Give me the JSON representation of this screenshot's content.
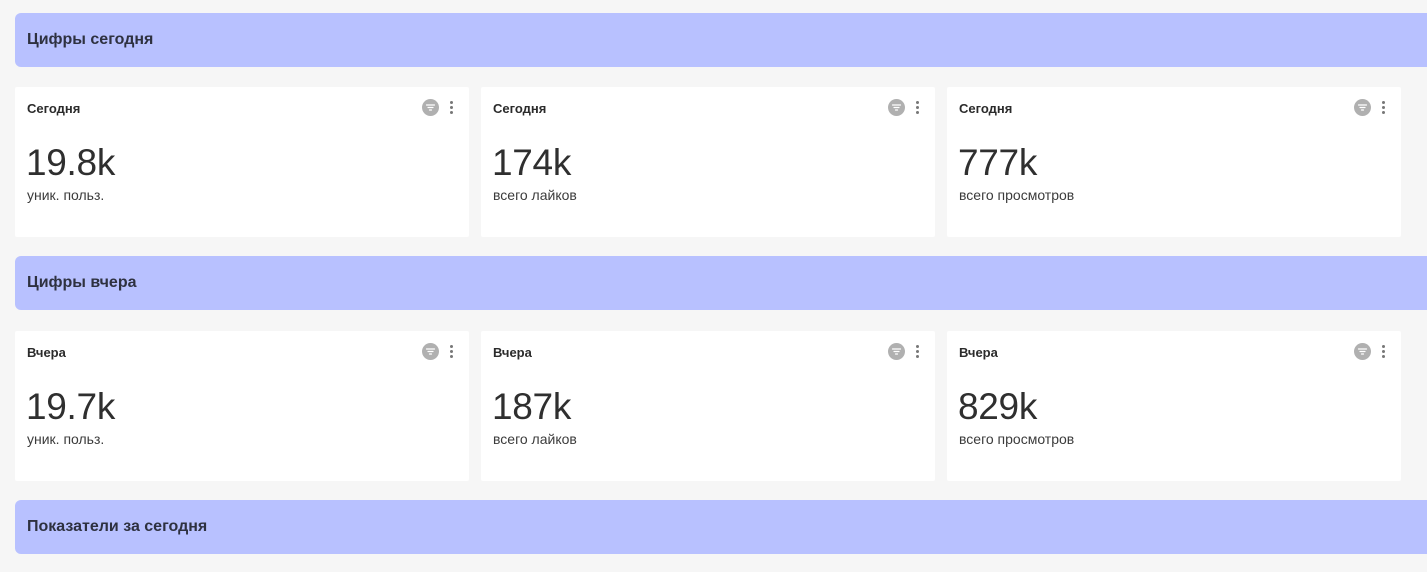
{
  "colors": {
    "page_background": "#f6f6f6",
    "section_header": "#b8c1ff",
    "card_background": "#ffffff",
    "icon_gray": "#b0b0b0"
  },
  "sections": [
    {
      "title": "Цифры сегодня",
      "cards": [
        {
          "title": "Сегодня",
          "value": "19.8k",
          "caption": "уник. польз.",
          "icons": [
            "filter-icon",
            "more-vertical-icon"
          ]
        },
        {
          "title": "Сегодня",
          "value": "174k",
          "caption": "всего лайков",
          "icons": [
            "filter-icon",
            "more-vertical-icon"
          ]
        },
        {
          "title": "Сегодня",
          "value": "777k",
          "caption": "всего просмотров",
          "icons": [
            "filter-icon",
            "more-vertical-icon"
          ]
        }
      ]
    },
    {
      "title": "Цифры вчера",
      "cards": [
        {
          "title": "Вчера",
          "value": "19.7k",
          "caption": "уник. польз.",
          "icons": [
            "filter-icon",
            "more-vertical-icon"
          ]
        },
        {
          "title": "Вчера",
          "value": "187k",
          "caption": "всего лайков",
          "icons": [
            "filter-icon",
            "more-vertical-icon"
          ]
        },
        {
          "title": "Вчера",
          "value": "829k",
          "caption": "всего просмотров",
          "icons": [
            "filter-icon",
            "more-vertical-icon"
          ]
        }
      ]
    },
    {
      "title": "Показатели за сегодня",
      "cards": []
    }
  ]
}
